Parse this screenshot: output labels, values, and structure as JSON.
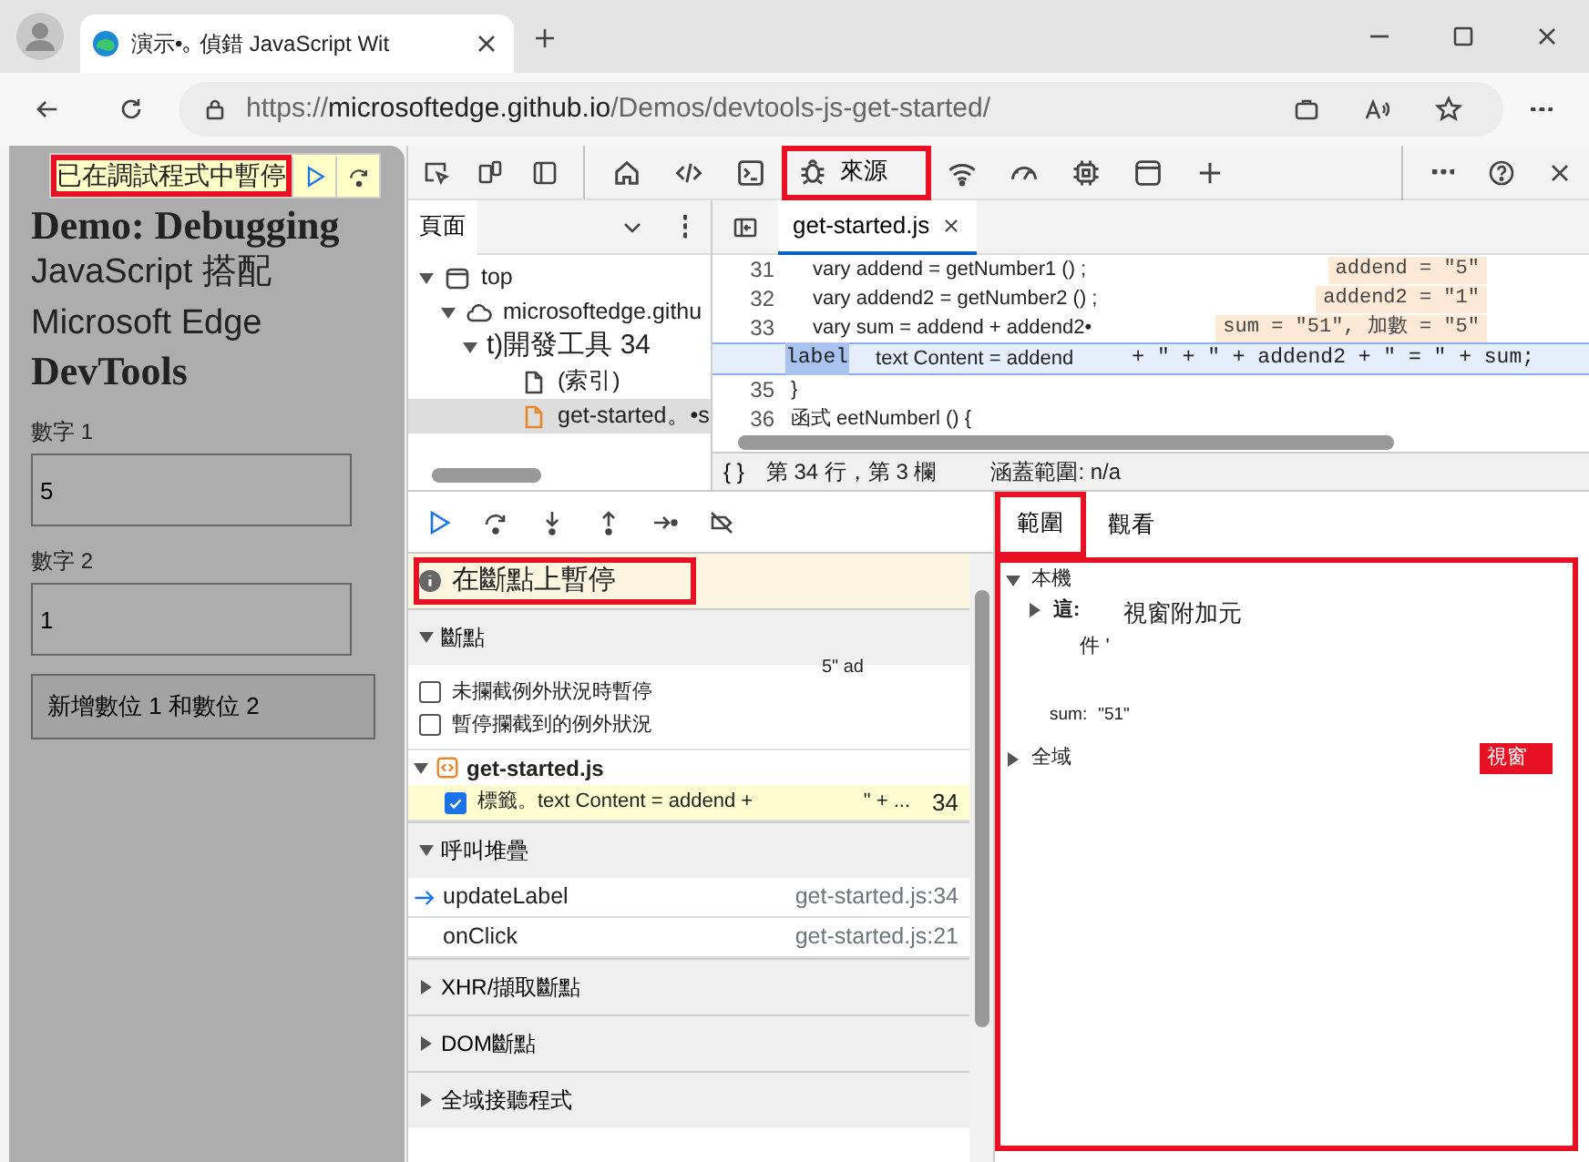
{
  "browser": {
    "tab_title": "演示•｡ 偵錯 JavaScript Wit",
    "url_scheme": "https://",
    "url_host": "microsoftedge.github.io",
    "url_path": "/Demos/devtools-js-get-started/"
  },
  "page": {
    "overlay": {
      "text": "已在調試程式中暫停",
      "callout": true
    },
    "heading": [
      {
        "kind": "serif",
        "text": "Demo: Debugging"
      },
      {
        "kind": "sans",
        "text": "JavaScript 搭配"
      },
      {
        "kind": "sans",
        "text": "Microsoft Edge"
      },
      {
        "kind": "serif",
        "text": "DevTools"
      }
    ],
    "fields": [
      {
        "label": "數字 1",
        "value": "5"
      },
      {
        "label": "數字 2",
        "value": "1"
      }
    ],
    "button": "新增數位 1 和數位 2"
  },
  "devtools": {
    "panel_tabs": [
      {
        "kind": "home",
        "selected": false,
        "callout": false
      },
      {
        "kind": "code",
        "selected": false,
        "callout": false
      },
      {
        "kind": "console",
        "selected": false,
        "callout": false
      },
      {
        "kind": "bug",
        "label": "來源",
        "selected": true,
        "callout": true
      },
      {
        "kind": "wifi",
        "selected": false,
        "callout": false
      },
      {
        "kind": "gauge",
        "selected": false,
        "callout": false
      },
      {
        "kind": "chip",
        "selected": false,
        "callout": false
      },
      {
        "kind": "window",
        "selected": false,
        "callout": false
      },
      {
        "kind": "plus",
        "selected": false,
        "callout": false
      }
    ],
    "navigator": {
      "header": "頁面",
      "tree": [
        {
          "kind": "frame",
          "label": "top",
          "expanded": true,
          "selected": false,
          "children": [
            {
              "kind": "cloud",
              "label": "microsoftedge.githu",
              "expanded": true,
              "selected": false,
              "children": [
                {
                  "kind": "folder",
                  "label": "t)開發工具 34",
                  "expanded": true,
                  "selected": false,
                  "children": [
                    {
                      "kind": "file",
                      "label": "(索引)",
                      "selected": false
                    },
                    {
                      "kind": "script",
                      "label": "get-started。•s",
                      "selected": true
                    }
                  ]
                }
              ]
            }
          ]
        }
      ]
    },
    "editor": {
      "tab": "get-started.js",
      "lines": [
        {
          "number": "31",
          "code": "vary addend = getNumber1 () ;",
          "inline_value": "addend = \"5\""
        },
        {
          "number": "32",
          "code": "vary addend2 = getNumber2 () ;",
          "inline_value": "addend2 = \"1\""
        },
        {
          "number": "33",
          "code": "vary sum = addend + addend2•",
          "inline_value": "sum = \"51\", 加數 = \"5\""
        },
        {
          "token": "label",
          "code": "text Content = addend",
          "tail": "+ \" + \" + addend2 + \" = \" + sum;",
          "current": true
        },
        {
          "number": "35",
          "code": "}"
        },
        {
          "number": "36",
          "code": "函式 eetNumberl () {"
        }
      ],
      "status": {
        "braces": "{ }",
        "position": "第 34 行，第 3 欄",
        "coverage": "涵蓋範圍: n/a"
      }
    },
    "debugger": {
      "paused": {
        "text": "在斷點上暫停",
        "callout": true
      },
      "breakpoints": {
        "title": "斷點",
        "expanded": true,
        "stray": "5\" ad",
        "options": [
          {
            "label": "未攔截例外狀況時暫停",
            "checked": false
          },
          {
            "label": "暫停攔截到的例外狀況",
            "checked": false
          }
        ],
        "file": "get-started.js",
        "items": [
          {
            "code": "標籤。text Content = addend +",
            "tail": "\" + ...",
            "line": "34",
            "checked": true
          }
        ]
      },
      "call_stack": {
        "title": "呼叫堆疊",
        "expanded": true,
        "frames": [
          {
            "name": "updateLabel",
            "location": "get-started.js:34",
            "current": true
          },
          {
            "name": "onClick",
            "location": "get-started.js:21",
            "current": false
          }
        ]
      },
      "sections": [
        {
          "title": "XHR/擷取斷點",
          "expanded": false
        },
        {
          "title": "DOM斷點",
          "expanded": false
        },
        {
          "title": "全域接聽程式",
          "expanded": false
        }
      ]
    },
    "sidebar": {
      "tabs": [
        {
          "label": "範圍",
          "selected": true,
          "callout": true
        },
        {
          "label": "觀看",
          "selected": false,
          "callout": false
        }
      ],
      "scope": {
        "callout": true,
        "groups": [
          {
            "label": "本機",
            "expanded": true,
            "entries": [
              {
                "kind": "object",
                "key": "這:",
                "value_lines": [
                  "視窗附加元",
                  "件 '"
                ],
                "expanded": false
              },
              {
                "kind": "value",
                "key": "sum:",
                "value": "\"51\""
              }
            ]
          },
          {
            "label": "全域",
            "expanded": false,
            "badge": "視窗"
          }
        ]
      }
    }
  }
}
